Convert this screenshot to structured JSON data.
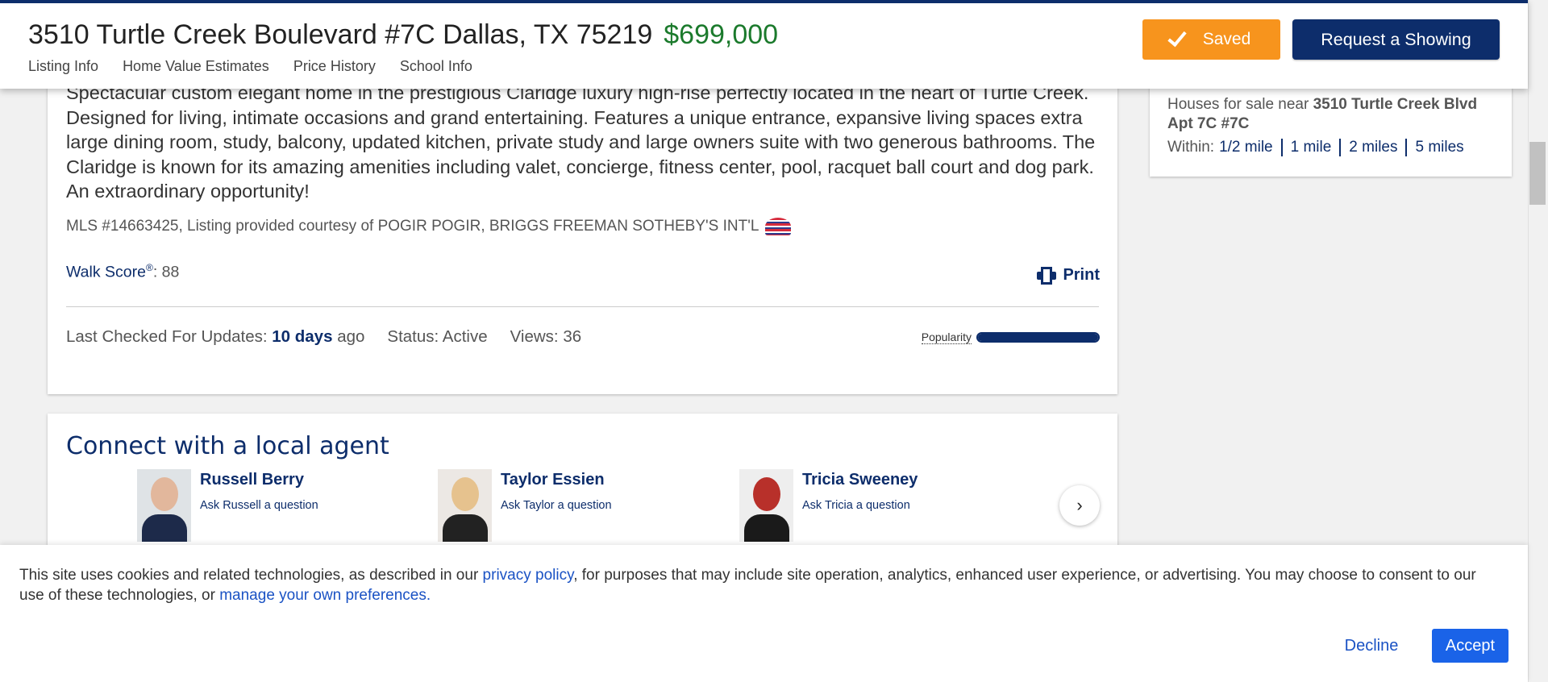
{
  "header": {
    "address": "3510 Turtle Creek Boulevard #7C Dallas, TX 75219",
    "price": "$699,000",
    "tabs": [
      {
        "label": "Listing Info"
      },
      {
        "label": "Home Value Estimates"
      },
      {
        "label": "Price History"
      },
      {
        "label": "School Info"
      }
    ],
    "saved_label": "Saved",
    "showing_label": "Request a Showing",
    "colors": {
      "brand": "#0d2d6b",
      "saved": "#f7941d",
      "price": "#1b7a2c"
    }
  },
  "listing": {
    "description": "Spectacular custom elegant home in the prestigious Claridge luxury high-rise perfectly located in the heart of Turtle Creek. Designed for living, intimate occasions and grand entertaining. Features a unique entrance, expansive living spaces extra large dining room, study, balcony, updated kitchen, private study and large owners suite with two generous bathrooms. The Claridge is known for its amazing amenities including valet, concierge, fitness center, pool, racquet ball court and dog park. An extraordinary opportunity!",
    "mls_text": "MLS #14663425, Listing provided courtesy of POGIR POGIR, BRIGGS FREEMAN SOTHEBY'S INT'L",
    "walk_score_label": "Walk Score",
    "walk_score_mark": "®",
    "walk_score_value": ": 88",
    "print_label": "Print",
    "last_checked_label": "Last Checked For Updates:",
    "last_checked_value": "10 days",
    "last_checked_suffix": "ago",
    "status": "Status: Active",
    "views": "Views: 36",
    "popularity_label": "Popularity",
    "popularity_fraction": 1.0
  },
  "agents": {
    "title": "Connect with a local agent",
    "items": [
      {
        "name": "Russell Berry",
        "ask": "Ask Russell a question"
      },
      {
        "name": "Taylor Essien",
        "ask": "Ask Taylor a question"
      },
      {
        "name": "Tricia Sweeney",
        "ask": "Ask Tricia a question"
      }
    ]
  },
  "sidebar": {
    "houses_prefix": "Houses for sale near",
    "houses_location": "3510 Turtle Creek Blvd Apt 7C #7C",
    "within_label": "Within:",
    "radii": [
      "1/2 mile",
      "1 mile",
      "2 miles",
      "5 miles"
    ]
  },
  "cookie": {
    "text_1": "This site uses cookies and related technologies, as described in our ",
    "privacy_link": "privacy policy",
    "text_2": ", for purposes that may include site operation, analytics, enhanced user experience, or advertising. You may choose to consent to our use of these technologies, or ",
    "prefs_link": "manage your own preferences.",
    "decline_label": "Decline",
    "accept_label": "Accept"
  }
}
